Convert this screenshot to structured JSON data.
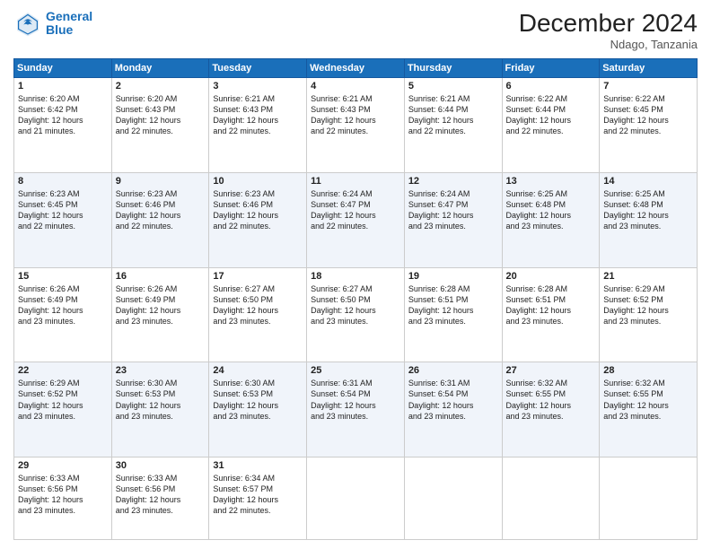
{
  "header": {
    "logo_line1": "General",
    "logo_line2": "Blue",
    "month": "December 2024",
    "location": "Ndago, Tanzania"
  },
  "weekdays": [
    "Sunday",
    "Monday",
    "Tuesday",
    "Wednesday",
    "Thursday",
    "Friday",
    "Saturday"
  ],
  "weeks": [
    [
      {
        "day": "1",
        "sunrise": "6:20 AM",
        "sunset": "6:42 PM",
        "daylight": "12 hours and 21 minutes."
      },
      {
        "day": "2",
        "sunrise": "6:20 AM",
        "sunset": "6:43 PM",
        "daylight": "12 hours and 22 minutes."
      },
      {
        "day": "3",
        "sunrise": "6:21 AM",
        "sunset": "6:43 PM",
        "daylight": "12 hours and 22 minutes."
      },
      {
        "day": "4",
        "sunrise": "6:21 AM",
        "sunset": "6:43 PM",
        "daylight": "12 hours and 22 minutes."
      },
      {
        "day": "5",
        "sunrise": "6:21 AM",
        "sunset": "6:44 PM",
        "daylight": "12 hours and 22 minutes."
      },
      {
        "day": "6",
        "sunrise": "6:22 AM",
        "sunset": "6:44 PM",
        "daylight": "12 hours and 22 minutes."
      },
      {
        "day": "7",
        "sunrise": "6:22 AM",
        "sunset": "6:45 PM",
        "daylight": "12 hours and 22 minutes."
      }
    ],
    [
      {
        "day": "8",
        "sunrise": "6:23 AM",
        "sunset": "6:45 PM",
        "daylight": "12 hours and 22 minutes."
      },
      {
        "day": "9",
        "sunrise": "6:23 AM",
        "sunset": "6:46 PM",
        "daylight": "12 hours and 22 minutes."
      },
      {
        "day": "10",
        "sunrise": "6:23 AM",
        "sunset": "6:46 PM",
        "daylight": "12 hours and 22 minutes."
      },
      {
        "day": "11",
        "sunrise": "6:24 AM",
        "sunset": "6:47 PM",
        "daylight": "12 hours and 22 minutes."
      },
      {
        "day": "12",
        "sunrise": "6:24 AM",
        "sunset": "6:47 PM",
        "daylight": "12 hours and 23 minutes."
      },
      {
        "day": "13",
        "sunrise": "6:25 AM",
        "sunset": "6:48 PM",
        "daylight": "12 hours and 23 minutes."
      },
      {
        "day": "14",
        "sunrise": "6:25 AM",
        "sunset": "6:48 PM",
        "daylight": "12 hours and 23 minutes."
      }
    ],
    [
      {
        "day": "15",
        "sunrise": "6:26 AM",
        "sunset": "6:49 PM",
        "daylight": "12 hours and 23 minutes."
      },
      {
        "day": "16",
        "sunrise": "6:26 AM",
        "sunset": "6:49 PM",
        "daylight": "12 hours and 23 minutes."
      },
      {
        "day": "17",
        "sunrise": "6:27 AM",
        "sunset": "6:50 PM",
        "daylight": "12 hours and 23 minutes."
      },
      {
        "day": "18",
        "sunrise": "6:27 AM",
        "sunset": "6:50 PM",
        "daylight": "12 hours and 23 minutes."
      },
      {
        "day": "19",
        "sunrise": "6:28 AM",
        "sunset": "6:51 PM",
        "daylight": "12 hours and 23 minutes."
      },
      {
        "day": "20",
        "sunrise": "6:28 AM",
        "sunset": "6:51 PM",
        "daylight": "12 hours and 23 minutes."
      },
      {
        "day": "21",
        "sunrise": "6:29 AM",
        "sunset": "6:52 PM",
        "daylight": "12 hours and 23 minutes."
      }
    ],
    [
      {
        "day": "22",
        "sunrise": "6:29 AM",
        "sunset": "6:52 PM",
        "daylight": "12 hours and 23 minutes."
      },
      {
        "day": "23",
        "sunrise": "6:30 AM",
        "sunset": "6:53 PM",
        "daylight": "12 hours and 23 minutes."
      },
      {
        "day": "24",
        "sunrise": "6:30 AM",
        "sunset": "6:53 PM",
        "daylight": "12 hours and 23 minutes."
      },
      {
        "day": "25",
        "sunrise": "6:31 AM",
        "sunset": "6:54 PM",
        "daylight": "12 hours and 23 minutes."
      },
      {
        "day": "26",
        "sunrise": "6:31 AM",
        "sunset": "6:54 PM",
        "daylight": "12 hours and 23 minutes."
      },
      {
        "day": "27",
        "sunrise": "6:32 AM",
        "sunset": "6:55 PM",
        "daylight": "12 hours and 23 minutes."
      },
      {
        "day": "28",
        "sunrise": "6:32 AM",
        "sunset": "6:55 PM",
        "daylight": "12 hours and 23 minutes."
      }
    ],
    [
      {
        "day": "29",
        "sunrise": "6:33 AM",
        "sunset": "6:56 PM",
        "daylight": "12 hours and 23 minutes."
      },
      {
        "day": "30",
        "sunrise": "6:33 AM",
        "sunset": "6:56 PM",
        "daylight": "12 hours and 23 minutes."
      },
      {
        "day": "31",
        "sunrise": "6:34 AM",
        "sunset": "6:57 PM",
        "daylight": "12 hours and 22 minutes."
      },
      null,
      null,
      null,
      null
    ]
  ]
}
